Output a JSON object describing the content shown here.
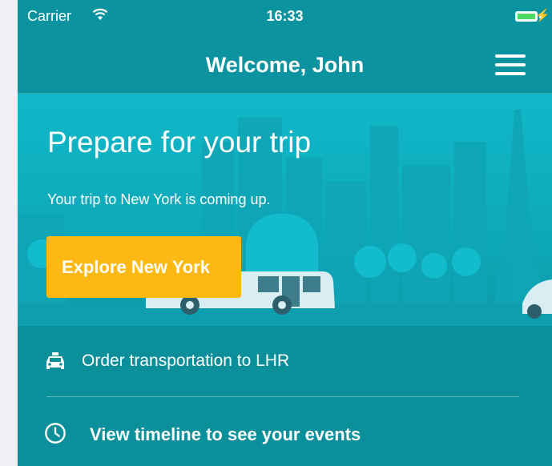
{
  "status_bar": {
    "carrier": "Carrier",
    "time": "16:33",
    "bolt": "⚡",
    "battery_color": "#4cd964"
  },
  "nav": {
    "title": "Welcome, John",
    "menu_icon": "hamburger-menu-icon"
  },
  "hero": {
    "title": "Prepare for your trip",
    "subtitle": "Your trip to New York is coming up.",
    "cta_label": "Explore New York",
    "cta_color": "#fdb813"
  },
  "actions": [
    {
      "label": "Order transportation to LHR",
      "icon": "taxi-icon"
    },
    {
      "label": "View timeline to see your events",
      "icon": "clock-icon"
    }
  ],
  "colors": {
    "primary": "#0b93a0",
    "hero": "#10b8c9"
  }
}
